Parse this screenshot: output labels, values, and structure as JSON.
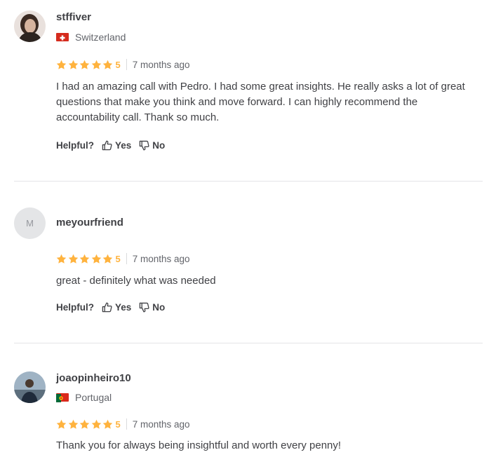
{
  "reviews": [
    {
      "username": "stffiver",
      "avatar_initial": "",
      "country": "Switzerland",
      "rating": "5",
      "time": "7 months ago",
      "text": "I had an amazing call with Pedro. I had some great insights. He really asks a lot of great questions that make you think and move forward. I can highly recommend the accountability call. Thank so much.",
      "helpful_label": "Helpful?",
      "yes_label": "Yes",
      "no_label": "No"
    },
    {
      "username": "meyourfriend",
      "avatar_initial": "M",
      "country": "",
      "rating": "5",
      "time": "7 months ago",
      "text": "great - definitely what was needed",
      "helpful_label": "Helpful?",
      "yes_label": "Yes",
      "no_label": "No"
    },
    {
      "username": "joaopinheiro10",
      "avatar_initial": "",
      "country": "Portugal",
      "rating": "5",
      "time": "7 months ago",
      "text": "Thank you for always being insightful and worth every penny!"
    }
  ],
  "colors": {
    "star": "#ffb33e",
    "divider": "#e4e5e7",
    "text": "#404145",
    "muted": "#62646a"
  },
  "icons": [
    "star-icon",
    "thumbs-up-icon",
    "thumbs-down-icon",
    "switzerland-flag-icon",
    "portugal-flag-icon"
  ]
}
